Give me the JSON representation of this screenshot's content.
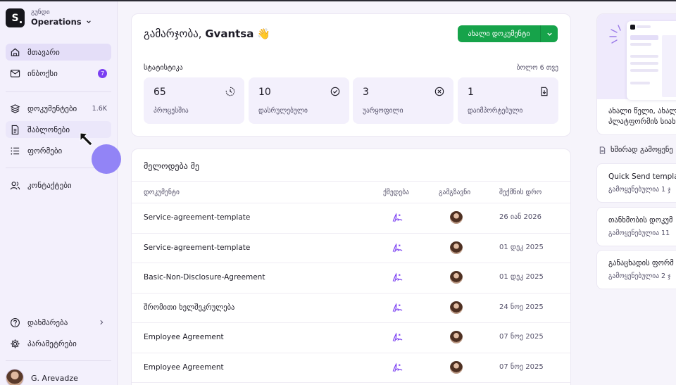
{
  "workspace": {
    "sub": "გუნდი",
    "name": "Operations",
    "logo_letter": "S"
  },
  "sidebar": {
    "items": [
      {
        "label": "მთავარი"
      },
      {
        "label": "ინბოქსი",
        "badge": "7"
      },
      {
        "label": "დოკუმენტები",
        "count": "1.6K"
      },
      {
        "label": "შაბლონები"
      },
      {
        "label": "ფორმები"
      },
      {
        "label": "კონტაქტები"
      }
    ],
    "help": "დახმარება",
    "settings": "პარამეტრები",
    "user": "G. Arevadze"
  },
  "greeting": {
    "text": "გამარჯობა, ",
    "name": "Gvantsa",
    "emoji": "👋",
    "new_button": "ახალი დოკუმენტი"
  },
  "stats": {
    "title": "სტატისტიკა",
    "period": "ბოლო 6 თვე",
    "items": [
      {
        "value": "65",
        "label": "პროცესშია",
        "icon": "clock-icon"
      },
      {
        "value": "10",
        "label": "დასრულებული",
        "icon": "check-circle-icon"
      },
      {
        "value": "3",
        "label": "უარყოფილი",
        "icon": "x-circle-icon"
      },
      {
        "value": "1",
        "label": "დაიმპორტებული",
        "icon": "file-import-icon"
      }
    ]
  },
  "waiting": {
    "title": "მელოდება მე",
    "columns": [
      "დოკუმენტი",
      "ქმედება",
      "გამგზავნი",
      "შექმნის დრო"
    ],
    "rows": [
      {
        "doc": "Service-agreement-template",
        "date": "26 იან 2026"
      },
      {
        "doc": "Service-agreement-template",
        "date": "01 დეკ 2025"
      },
      {
        "doc": "Basic-Non-Disclosure-Agreement",
        "date": "01 დეკ 2025"
      },
      {
        "doc": "შრომითი ხელშეკრულება",
        "date": "24 ნოე 2025"
      },
      {
        "doc": "Employee Agreement",
        "date": "07 ნოე 2025"
      },
      {
        "doc": "Employee Agreement",
        "date": "07 ნოე 2025"
      }
    ]
  },
  "promo": {
    "line1": "ახალი წელი, ახალ",
    "line2": "პლატფორმის სიახ"
  },
  "frequent": {
    "title": "ხშირად გამოყენე",
    "items": [
      {
        "name": "Quick Send template",
        "usage": "გამოყენებულია 1 ჯ"
      },
      {
        "name": "თანხმობის დოკუმ",
        "usage": "გამოყენებულია 11"
      },
      {
        "name": "განაცხადის ფორმ",
        "usage": "გამოყენებულია 2 ჯ"
      }
    ]
  },
  "colors": {
    "accent": "#7b3ff2",
    "primary_button": "#16a34a",
    "active_nav": "#e4def8"
  }
}
